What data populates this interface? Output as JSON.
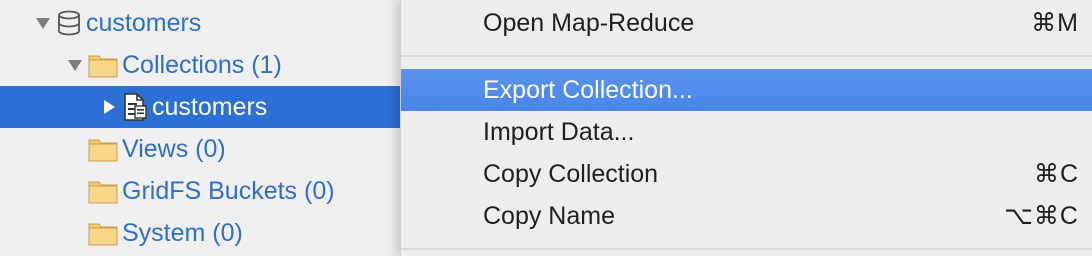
{
  "sidebar": {
    "database": {
      "label": "customers",
      "icon": "database-icon"
    },
    "collections_folder": {
      "label": "Collections (1)",
      "icon": "folder-icon"
    },
    "collection": {
      "label": "customers",
      "icon": "collection-document-icon"
    },
    "views_folder": {
      "label": "Views (0)",
      "icon": "folder-icon"
    },
    "gridfs_folder": {
      "label": "GridFS Buckets (0)",
      "icon": "folder-icon"
    },
    "system_folder": {
      "label": "System (0)",
      "icon": "folder-icon"
    }
  },
  "context_menu": {
    "items": [
      {
        "label": "Open Map-Reduce",
        "shortcut": "⌘M"
      },
      {
        "label": "Export Collection...",
        "shortcut": ""
      },
      {
        "label": "Import Data...",
        "shortcut": ""
      },
      {
        "label": "Copy Collection",
        "shortcut": "⌘C"
      },
      {
        "label": "Copy Name",
        "shortcut": "⌥⌘C"
      }
    ]
  },
  "colors": {
    "sidebar_text": "#2f6fcc",
    "selection_bg": "#2c6fd6",
    "menu_highlight": "#4a86ec",
    "folder": "#f6c76a"
  }
}
